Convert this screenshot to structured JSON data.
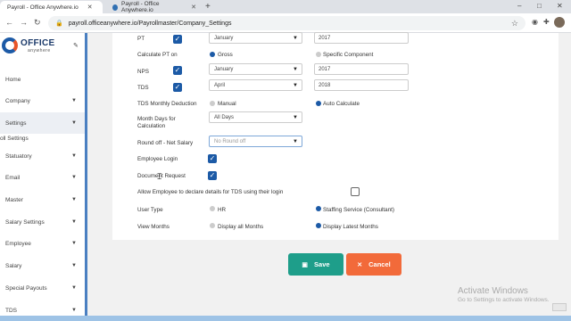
{
  "browser": {
    "tabs": [
      {
        "title": "Payroll - Office Anywhere.io",
        "active": true
      },
      {
        "title": "Payroll - Office Anywhere.io",
        "active": false
      }
    ],
    "new_tab": "+",
    "url": "payroll.officeanywhere.io/Payrollmaster/Company_Settings",
    "window_controls": [
      "–",
      "□",
      "✕"
    ]
  },
  "logo": {
    "name": "OFFICE",
    "sub": "anywhere"
  },
  "sidebar": {
    "items": [
      {
        "label": "Home",
        "has_chevron": false
      },
      {
        "label": "Company",
        "has_chevron": true
      },
      {
        "label": "Settings",
        "has_chevron": true
      },
      {
        "label": "Statuatory",
        "has_chevron": true
      },
      {
        "label": "Email",
        "has_chevron": true
      },
      {
        "label": "Master",
        "has_chevron": true
      },
      {
        "label": "Salary Settings",
        "has_chevron": true
      },
      {
        "label": "Employee",
        "has_chevron": true
      },
      {
        "label": "Salary",
        "has_chevron": true
      },
      {
        "label": "Special Payouts",
        "has_chevron": true
      },
      {
        "label": "TDS",
        "has_chevron": true
      }
    ],
    "submenu": "oll Settings"
  },
  "form": {
    "pt": {
      "label": "PT",
      "checked": true,
      "month": "January",
      "year": "2017"
    },
    "calc_pt": {
      "label": "Calculate PT on",
      "opt1": "Gross",
      "opt2": "Specific Component",
      "selected": "Gross"
    },
    "nps": {
      "label": "NPS",
      "checked": true,
      "month": "January",
      "year": "2017"
    },
    "tds": {
      "label": "TDS",
      "checked": true,
      "month": "April",
      "year": "2018"
    },
    "tds_monthly": {
      "label": "TDS Monthly Deduction",
      "opt1": "Manual",
      "opt2": "Auto Calculate",
      "selected": "Auto Calculate"
    },
    "month_days": {
      "label_line1": "Month Days for",
      "label_line2": "Calculation",
      "value": "All Days"
    },
    "round_off": {
      "label": "Round off - Net Salary",
      "placeholder": "No Round off"
    },
    "employee_login": {
      "label": "Employee Login",
      "checked": true
    },
    "document_request": {
      "label": "Document Request",
      "checked": true
    },
    "tds_declare": {
      "label": "Allow Employee to declare details for TDS using their login",
      "checked": false
    },
    "user_type": {
      "label": "User Type",
      "opt1": "HR",
      "opt2": "Staffing Service (Consultant)",
      "selected": "Staffing Service (Consultant)"
    },
    "view_months": {
      "label": "View Months",
      "opt1": "Display all Months",
      "opt2": "Display Latest Months",
      "selected": "Display Latest Months"
    }
  },
  "actions": {
    "save": "Save",
    "cancel": "Cancel"
  },
  "watermark": {
    "title": "Activate Windows",
    "subtitle": "Go to Settings to activate Windows."
  }
}
